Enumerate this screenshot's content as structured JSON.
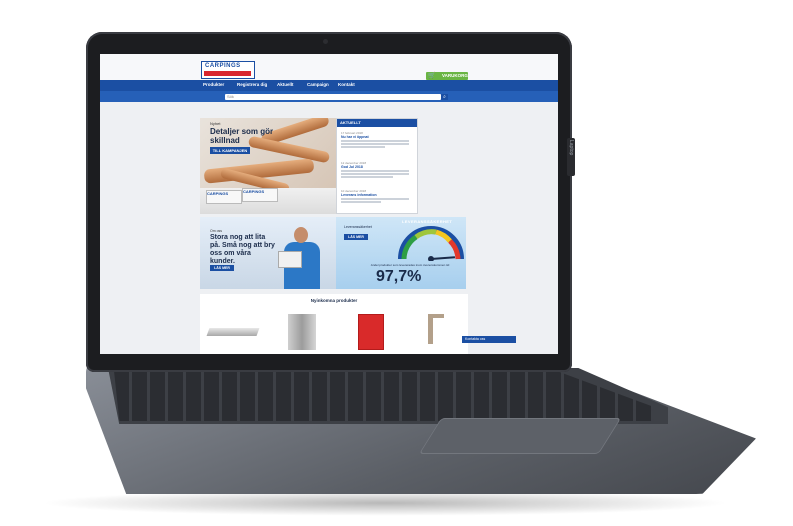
{
  "header": {
    "logo_text": "CARPINGS",
    "cart_label": "VARUKORG"
  },
  "nav": {
    "items": [
      "Produkter",
      "Registrera dig",
      "Aktuellt",
      "Campaign",
      "Kontakt"
    ]
  },
  "search": {
    "placeholder": "Sök"
  },
  "hero": {
    "label": "Nyhet",
    "title": "Detaljer som gör skillnad",
    "button": "TILL KAMPANJEN",
    "packaging_1": "CARPINGS",
    "packaging_2": "CARPINGS"
  },
  "news": {
    "header": "AKTUELLT",
    "items": [
      {
        "date": "17 februari 2018",
        "title": "Nu har vi öppnat"
      },
      {
        "date": "12 december 2018",
        "title": "God Jul 2018"
      },
      {
        "date": "10 december 2018",
        "title": "Leverans information"
      }
    ]
  },
  "promo": {
    "label": "Om oss",
    "title": "Stora nog att lita på. Små nog att bry oss om våra kunder.",
    "button": "LÄS MER"
  },
  "delivery": {
    "label": "Leveranssäkerhet",
    "button": "LÄS MER",
    "arc_title": "LEVERANSSÄKERHET",
    "subtitle": "Andel produkter som levererades inom överenskommen tid",
    "value": "97,7%",
    "value_percent": 97.7
  },
  "new_products": {
    "title": "Nyinkomna produkter"
  },
  "chat": {
    "label": "Kontakta oss"
  },
  "device": {
    "side_tag": "Laptop"
  }
}
